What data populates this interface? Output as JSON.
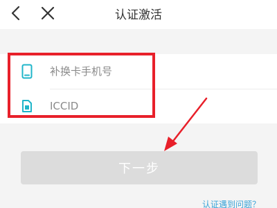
{
  "header": {
    "title": "认证激活",
    "back_icon": "back-arrow-icon",
    "close_icon": "close-icon"
  },
  "form": {
    "phone": {
      "icon": "sim-card-icon",
      "placeholder": "补换卡手机号",
      "value": ""
    },
    "iccid": {
      "icon": "iccid-chip-icon",
      "placeholder": "ICCID",
      "value": ""
    }
  },
  "next_button": {
    "label": "下一步",
    "disabled": true
  },
  "help_link": {
    "label": "认证遇到问题？"
  },
  "colors": {
    "accent": "#1fb5c9",
    "highlight": "#e8202a",
    "link": "#3aa4d8",
    "button_disabled": "#dcdcdc"
  }
}
